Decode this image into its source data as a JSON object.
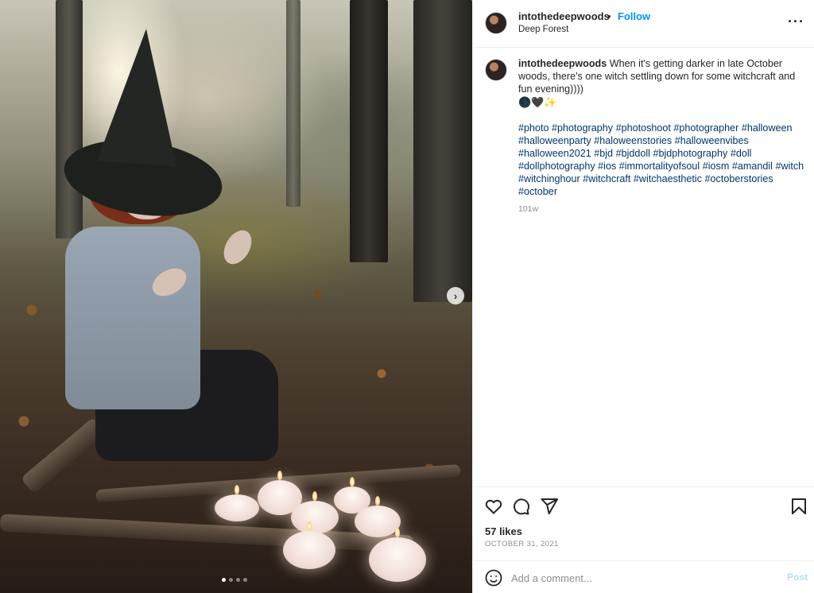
{
  "post": {
    "username": "intothedeepwoods",
    "separator": "•",
    "follow_label": "Follow",
    "location": "Deep Forest",
    "caption_text": "When it's getting darker in late October woods, there's one witch settling down for some witchcraft and fun evening))))",
    "emoji": "🌑🖤✨",
    "hashtags": [
      "#photo",
      "#photography",
      "#photoshoot",
      "#photographer",
      "#halloween",
      "#halloweenparty",
      "#haloweenstories",
      "#halloweenvibes",
      "#halloween2021",
      "#bjd",
      "#bjddoll",
      "#bjdphotography",
      "#doll",
      "#dollphotography",
      "#ios",
      "#immortalityofsoul",
      "#iosm",
      "#amandil",
      "#witch",
      "#witchinghour",
      "#witchcraft",
      "#witchaesthetic",
      "#octoberstories",
      "#october"
    ],
    "time_ago": "101w",
    "likes": "57 likes",
    "date": "OCTOBER 31, 2021"
  },
  "carousel": {
    "next_glyph": "›",
    "slide_count": 4,
    "active_index": 0
  },
  "comment": {
    "placeholder": "Add a comment...",
    "post_label": "Post"
  },
  "icons": {
    "more": "more-options-icon",
    "like": "heart-icon",
    "comment": "comment-icon",
    "share": "share-icon",
    "save": "bookmark-icon",
    "emoji": "smile-icon"
  },
  "colors": {
    "link_blue": "#0095f6",
    "hashtag_blue": "#00376b",
    "muted_gray": "#8e8e8e",
    "post_disabled": "#b2dffc"
  }
}
